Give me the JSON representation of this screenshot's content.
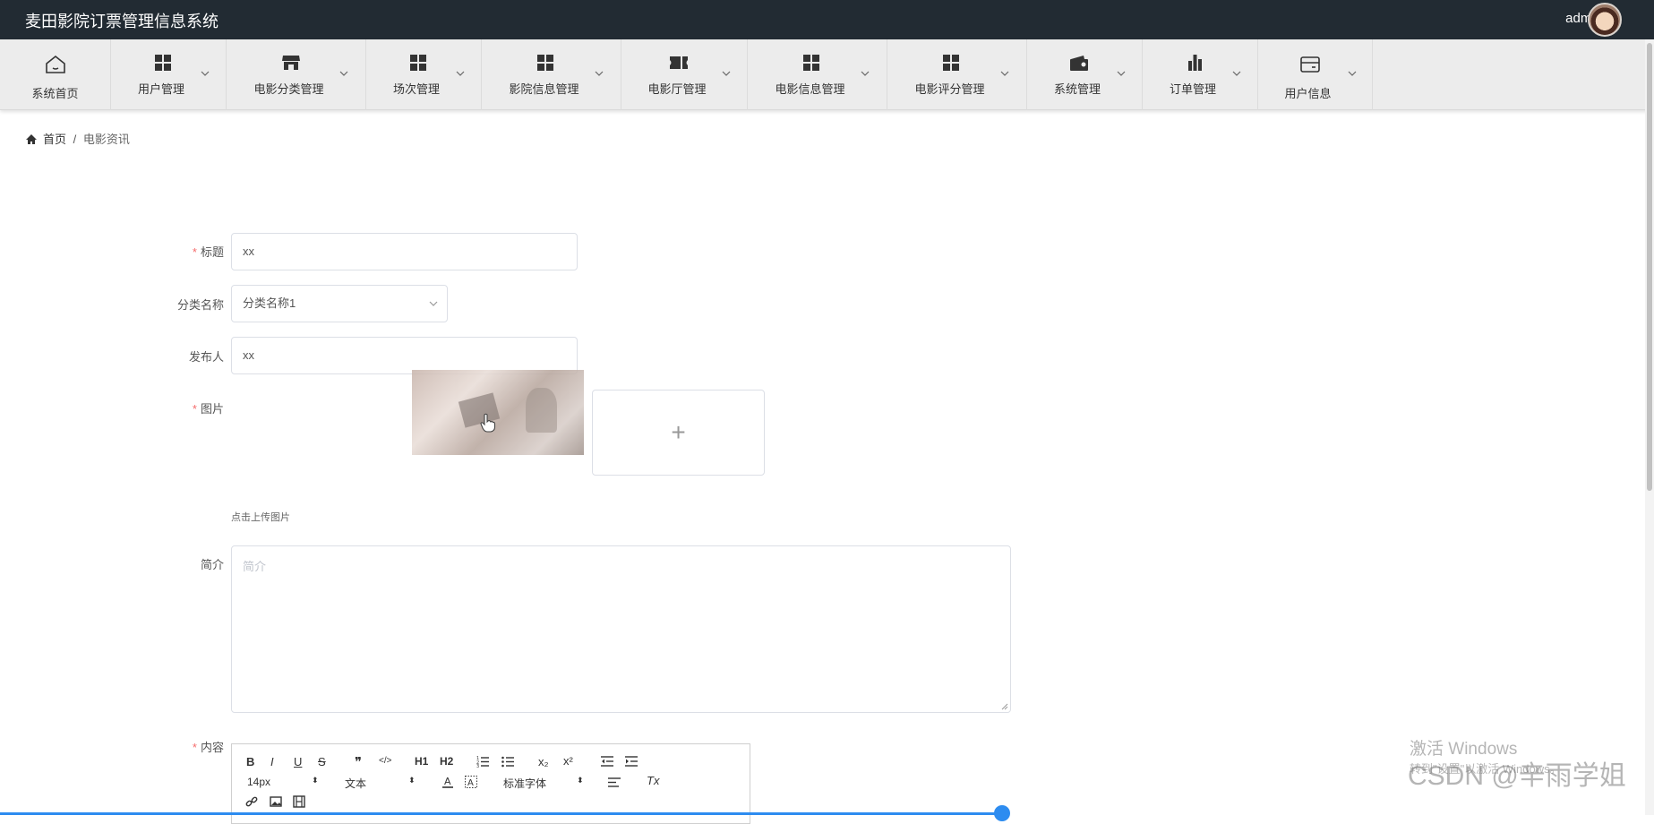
{
  "app": {
    "title": "麦田影院订票管理信息系统",
    "user": "admin"
  },
  "nav": [
    {
      "label": "系统首页",
      "icon": "home-icon"
    },
    {
      "label": "用户管理",
      "icon": "grid-icon"
    },
    {
      "label": "电影分类管理",
      "icon": "store-icon"
    },
    {
      "label": "场次管理",
      "icon": "grid-icon"
    },
    {
      "label": "影院信息管理",
      "icon": "grid-icon"
    },
    {
      "label": "电影厅管理",
      "icon": "ticket-icon"
    },
    {
      "label": "电影信息管理",
      "icon": "grid-icon"
    },
    {
      "label": "电影评分管理",
      "icon": "grid-icon"
    },
    {
      "label": "系统管理",
      "icon": "wallet-icon"
    },
    {
      "label": "订单管理",
      "icon": "bar-chart-icon"
    },
    {
      "label": "用户信息",
      "icon": "card-icon"
    }
  ],
  "breadcrumb": {
    "home": "首页",
    "separator": "/",
    "current": "电影资讯"
  },
  "form": {
    "title_label": "标题",
    "title_value": "xx",
    "category_label": "分类名称",
    "category_value": "分类名称1",
    "publisher_label": "发布人",
    "publisher_value": "xx",
    "image_label": "图片",
    "upload_plus": "+",
    "upload_hint": "点击上传图片",
    "intro_label": "简介",
    "intro_placeholder": "简介",
    "content_label": "内容",
    "required_mark": "*"
  },
  "editor": {
    "bold": "B",
    "italic": "I",
    "underline": "U",
    "strike": "S",
    "quote": "❞",
    "code": "</>",
    "h1": "H1",
    "h2": "H2",
    "sub": "x₂",
    "sup": "x²",
    "size": "14px",
    "header": "文本",
    "font": "标准字体",
    "clear": "Tx"
  },
  "watermark": {
    "activate": "激活 Windows",
    "activate_sub": "转到\"设置\"以激活 Windows。",
    "csdn": "CSDN @辛雨学姐"
  },
  "colors": {
    "topbar": "#222b33",
    "navbar": "#ececec",
    "accent": "#2d8cf0",
    "required": "#f56c6c"
  }
}
